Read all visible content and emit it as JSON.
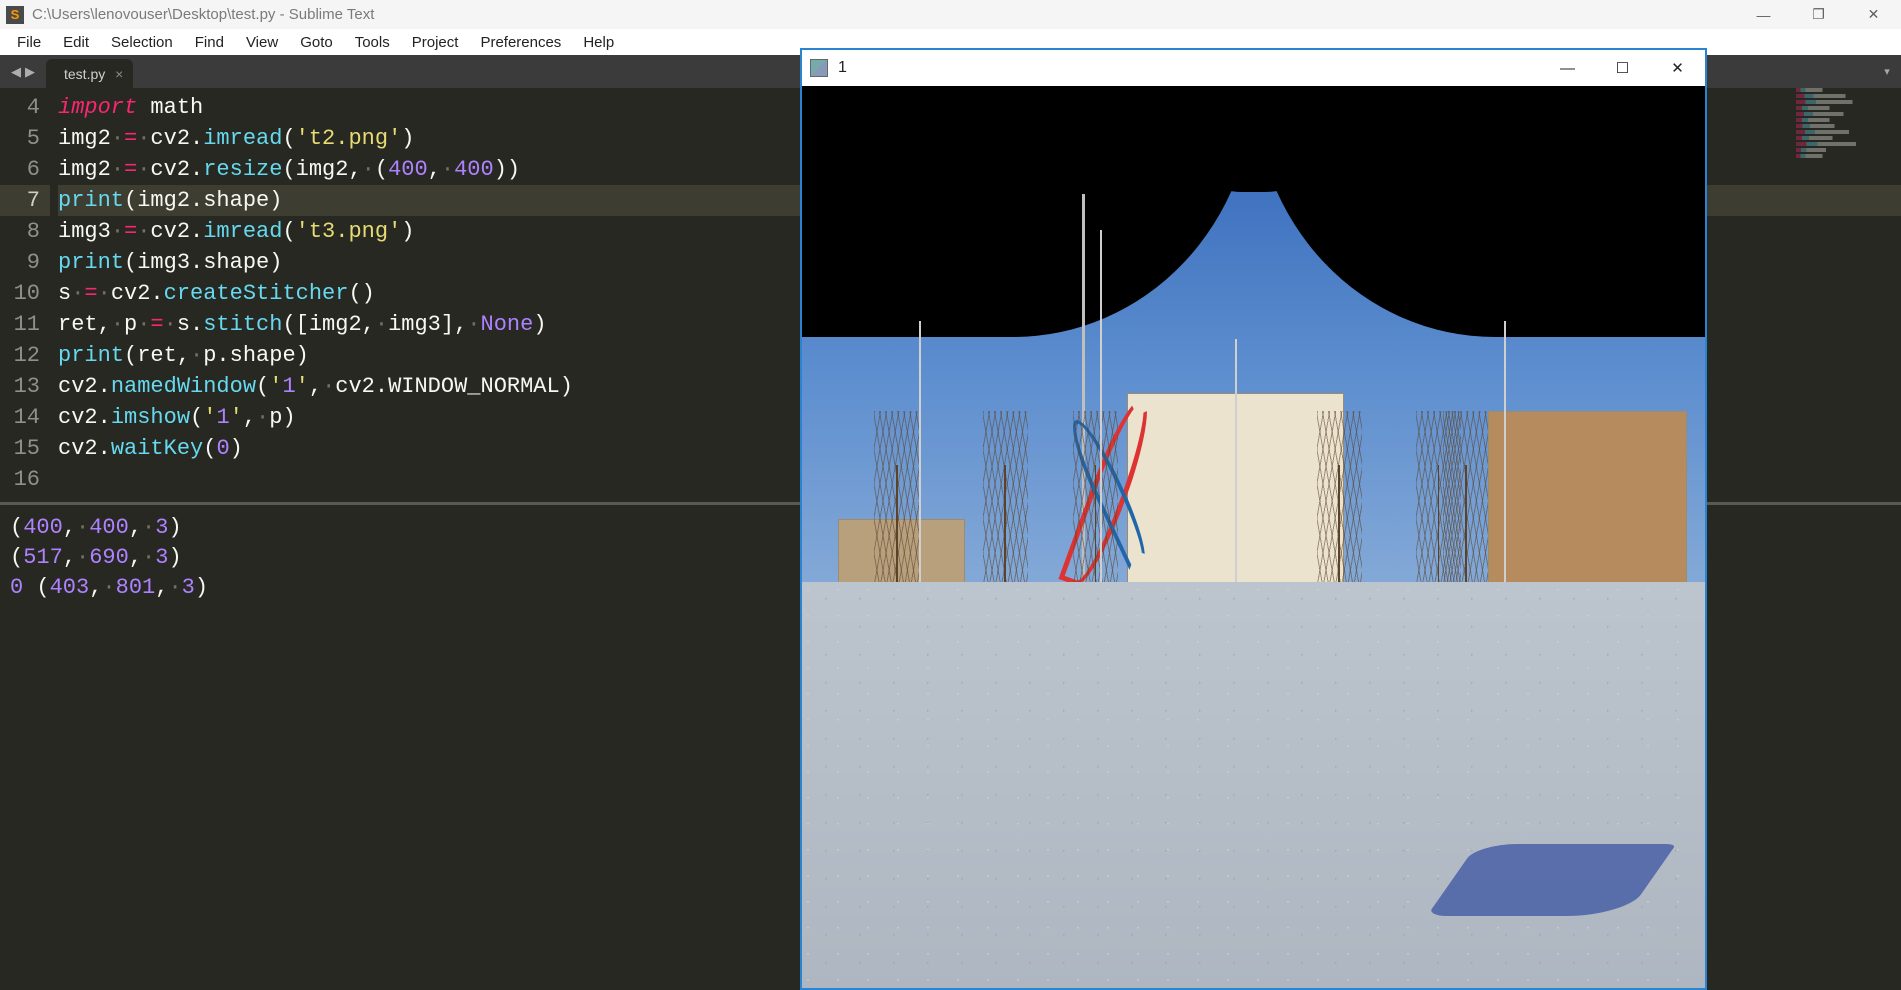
{
  "main_window": {
    "title": "C:\\Users\\lenovouser\\Desktop\\test.py - Sublime Text",
    "controls": {
      "minimize": "—",
      "maximize": "❐",
      "close": "✕"
    }
  },
  "menu": [
    "File",
    "Edit",
    "Selection",
    "Find",
    "View",
    "Goto",
    "Tools",
    "Project",
    "Preferences",
    "Help"
  ],
  "tabs": {
    "nav_back": "◀",
    "nav_fwd": "▶",
    "active": "test.py",
    "close": "×",
    "overflow": "▾"
  },
  "editor": {
    "first_line_number": 4,
    "highlighted_line": 7,
    "lines": [
      "import math",
      "img2 = cv2.imread('t2.png')",
      "img2 = cv2.resize(img2, (400, 400))",
      "print(img2.shape)",
      "img3 = cv2.imread('t3.png')",
      "print(img3.shape)",
      "s = cv2.createStitcher()",
      "ret, p = s.stitch([img2, img3], None)",
      "print(ret, p.shape)",
      "cv2.namedWindow('1', cv2.WINDOW_NORMAL)",
      "cv2.imshow('1', p)",
      "cv2.waitKey(0)",
      ""
    ]
  },
  "console_output": [
    "(400, 400, 3)",
    "(517, 690, 3)",
    "0 (403, 801, 3)"
  ],
  "cv_window": {
    "title": "1",
    "controls": {
      "minimize": "—",
      "maximize": "☐",
      "close": "✕"
    }
  }
}
